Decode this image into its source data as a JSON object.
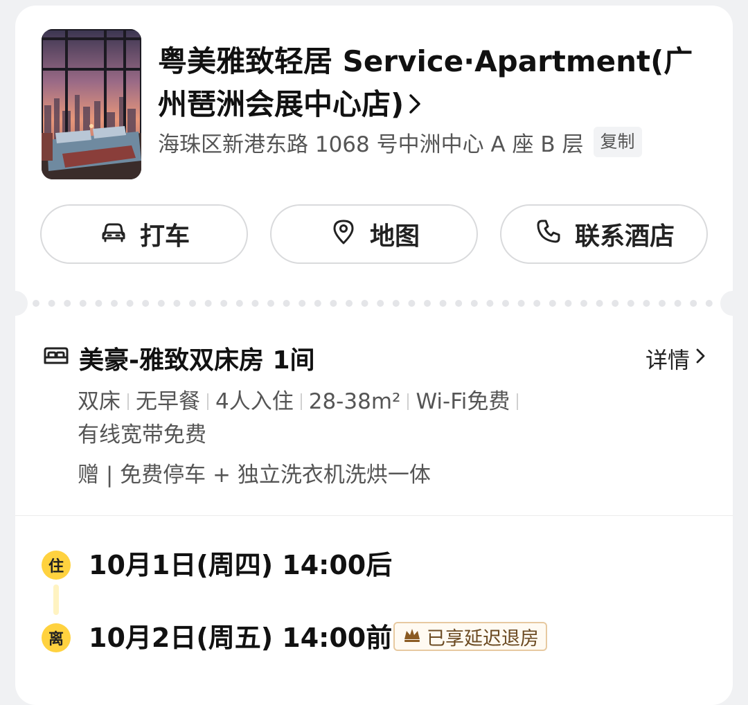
{
  "hotel": {
    "name": "粤美雅致轻居 Service·Apartment(广州琶洲会展中心店)",
    "address": "海珠区新港东路 1068 号中洲中心 A 座 B 层",
    "copy_label": "复制"
  },
  "actions": {
    "taxi_label": "打车",
    "map_label": "地图",
    "contact_label": "联系酒店"
  },
  "room": {
    "title": "美豪-雅致双床房 1间",
    "details_label": "详情",
    "facilities": [
      "双床",
      "无早餐",
      "4人入住",
      "28-38m²",
      "Wi-Fi免费",
      "有线宽带免费"
    ],
    "gift": "赠 | 免费停车 + 独立洗衣机洗烘一体"
  },
  "stay": {
    "checkin_badge": "住",
    "checkin": "10月1日(周四) 14:00后",
    "checkout_badge": "离",
    "checkout": "10月2日(周五) 14:00前",
    "late_checkout_tag": "已享延迟退房"
  },
  "colors": {
    "badge": "#ffd23f",
    "tag_border": "#e7c9a0",
    "tag_text": "#6b4a22"
  },
  "icons": [
    "car-icon",
    "location-pin-icon",
    "phone-icon",
    "bed-icon",
    "chevron-right-icon",
    "crown-icon"
  ]
}
